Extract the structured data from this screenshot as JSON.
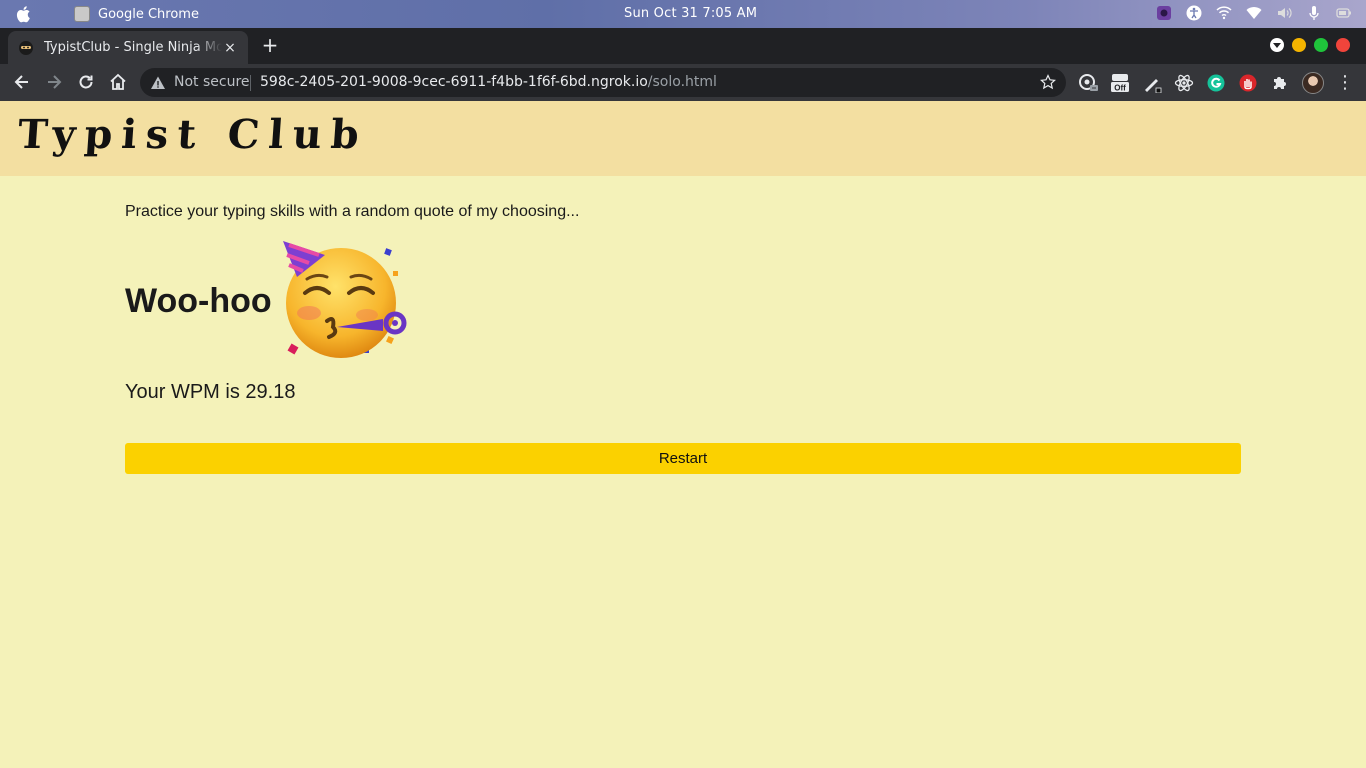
{
  "os": {
    "app_name": "Google Chrome",
    "clock": "Sun Oct 31   7:05 AM"
  },
  "browser": {
    "tab_title": "TypistClub - Single Ninja Mode",
    "tab_close": "×",
    "new_tab": "+",
    "not_secure": "Not secure",
    "url_host": "598c-2405-201-9008-9cec-6911-f4bb-1f6f-6bd.ngrok.io",
    "url_path": "/solo.html",
    "menu": "⋮"
  },
  "site": {
    "logo": "Typist Club",
    "tagline": "Practice your typing skills with a random quote of my choosing...",
    "result_heading": "Woo-hoo",
    "wpm_text": "Your WPM is 29.18",
    "restart_label": "Restart"
  },
  "colors": {
    "page_bg": "#f4f2b9",
    "header_bg": "#f3dfa1",
    "button_bg": "#fbd100"
  }
}
